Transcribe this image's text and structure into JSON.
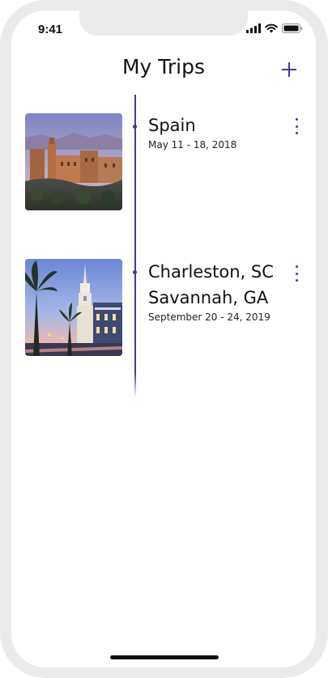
{
  "status_bar": {
    "time": "9:41",
    "icons": [
      "cellular-signal-icon",
      "wifi-icon",
      "battery-icon"
    ]
  },
  "header": {
    "title": "My Trips",
    "add_icon": "plus-icon"
  },
  "colors": {
    "accent": "#3d3aa0",
    "text": "#111111",
    "device_frame": "#ebebeb"
  },
  "trips": [
    {
      "name_lines": [
        "Spain"
      ],
      "dates": "May 11 - 18, 2018",
      "image": "alhambra-palace-photo",
      "menu_icon": "more-vertical-icon"
    },
    {
      "name_lines": [
        "Charleston, SC",
        "Savannah, GA"
      ],
      "dates": "September 20 - 24, 2019",
      "image": "charleston-street-church-photo",
      "menu_icon": "more-vertical-icon"
    }
  ]
}
